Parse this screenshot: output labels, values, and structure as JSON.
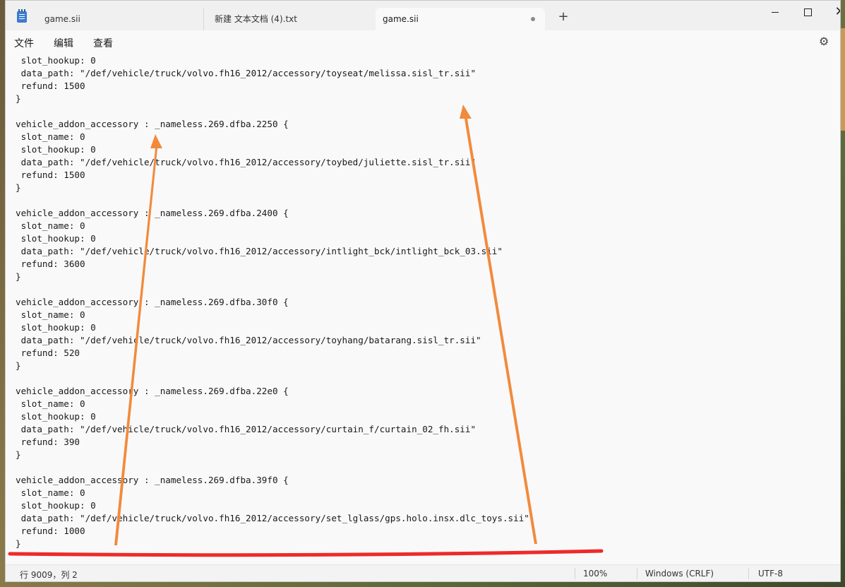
{
  "tabs": [
    {
      "label": "game.sii"
    },
    {
      "label": "新建 文本文档 (4).txt"
    },
    {
      "label": "game.sii",
      "active": true,
      "unsaved": true
    }
  ],
  "window_controls": {
    "minimize": "minimize",
    "maximize": "maximize",
    "close": "✕"
  },
  "new_tab_label": "+",
  "menu": [
    "文件",
    "编辑",
    "查看"
  ],
  "settings_icon": "gear-icon",
  "code_lines": [
    " slot_hookup: 0",
    " data_path: \"/def/vehicle/truck/volvo.fh16_2012/accessory/toyseat/melissa.sisl_tr.sii\"",
    " refund: 1500",
    "}",
    "",
    "vehicle_addon_accessory : _nameless.269.dfba.2250 {",
    " slot_name: 0",
    " slot_hookup: 0",
    " data_path: \"/def/vehicle/truck/volvo.fh16_2012/accessory/toybed/juliette.sisl_tr.sii\"",
    " refund: 1500",
    "}",
    "",
    "vehicle_addon_accessory : _nameless.269.dfba.2400 {",
    " slot_name: 0",
    " slot_hookup: 0",
    " data_path: \"/def/vehicle/truck/volvo.fh16_2012/accessory/intlight_bck/intlight_bck_03.sii\"",
    " refund: 3600",
    "}",
    "",
    "vehicle_addon_accessory : _nameless.269.dfba.30f0 {",
    " slot_name: 0",
    " slot_hookup: 0",
    " data_path: \"/def/vehicle/truck/volvo.fh16_2012/accessory/toyhang/batarang.sisl_tr.sii\"",
    " refund: 520",
    "}",
    "",
    "vehicle_addon_accessory : _nameless.269.dfba.22e0 {",
    " slot_name: 0",
    " slot_hookup: 0",
    " data_path: \"/def/vehicle/truck/volvo.fh16_2012/accessory/curtain_f/curtain_02_fh.sii\"",
    " refund: 390",
    "}",
    "",
    "vehicle_addon_accessory : _nameless.269.dfba.39f0 {",
    " slot_name: 0",
    " slot_hookup: 0",
    " data_path: \"/def/vehicle/truck/volvo.fh16_2012/accessory/set_lglass/gps.holo.insx.dlc_toys.sii\"",
    " refund: 1000",
    "}"
  ],
  "status": {
    "position": "行 9009，列 2",
    "zoom": "100%",
    "line_ending": "Windows (CRLF)",
    "encoding": "UTF-8"
  },
  "colors": {
    "annotation_arrow": "#f28a3c",
    "annotation_underline": "#ee2a2a"
  }
}
